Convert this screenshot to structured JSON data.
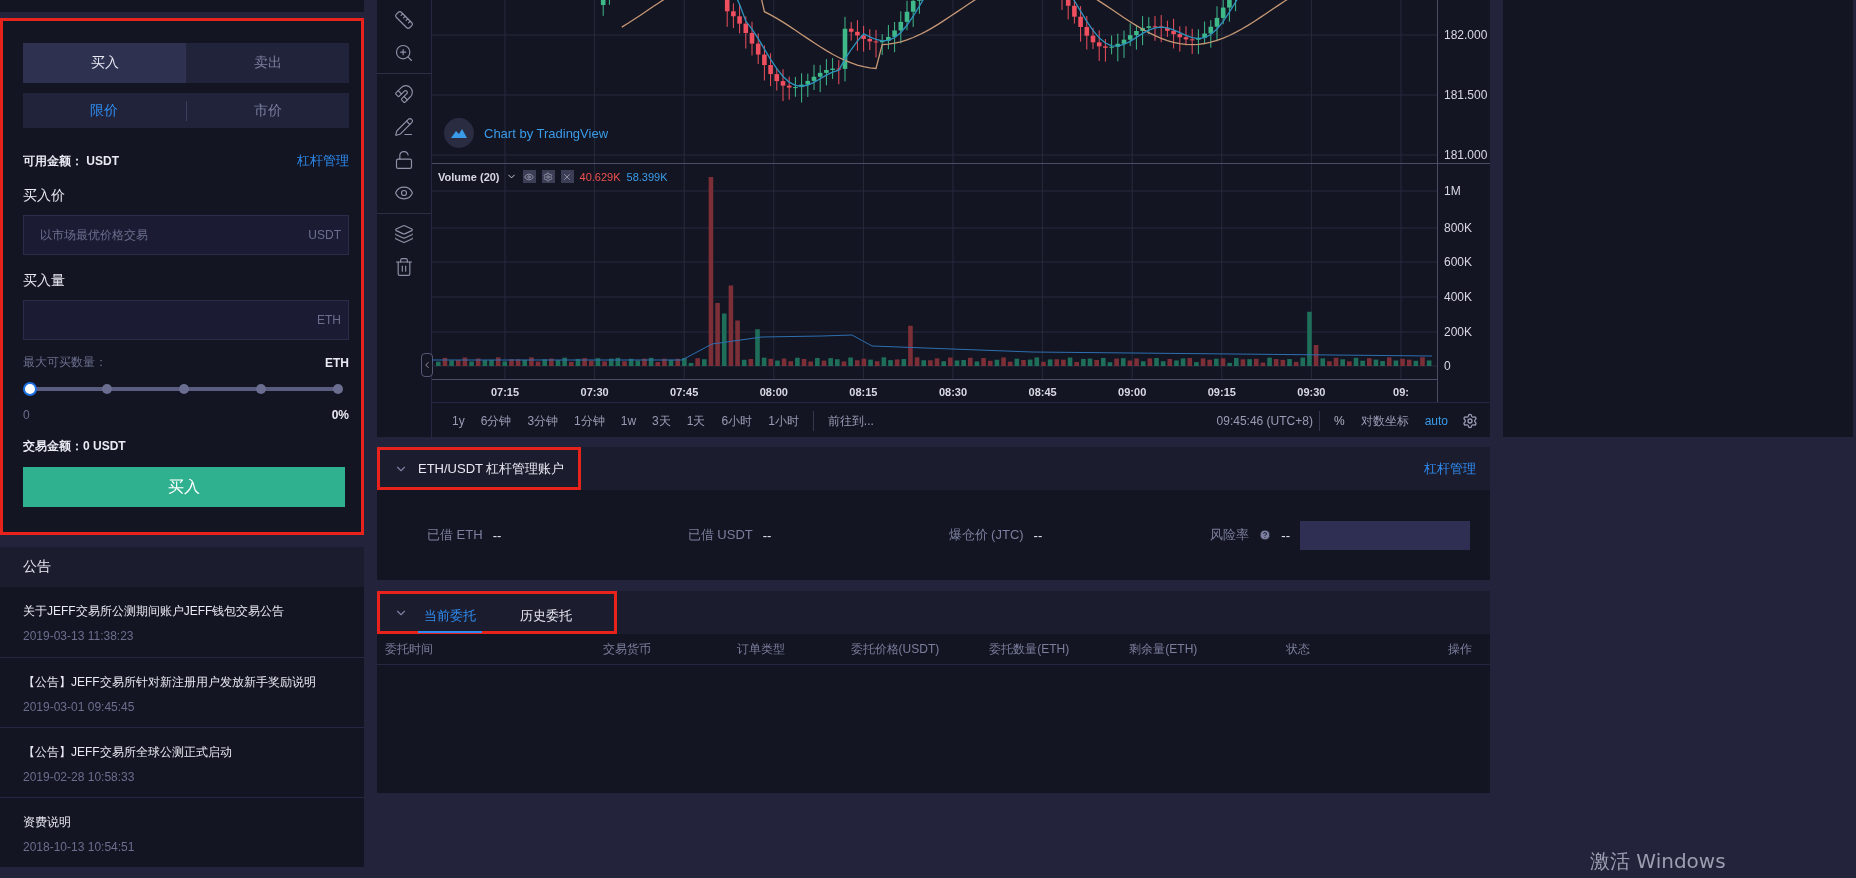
{
  "order_panel": {
    "annotated": true,
    "side_tabs": [
      {
        "label": "买入",
        "selected": true
      },
      {
        "label": "卖出",
        "selected": false
      }
    ],
    "type_tabs": [
      {
        "label": "限价",
        "selected": true
      },
      {
        "label": "市价",
        "selected": false
      }
    ],
    "available": "可用金额： USDT",
    "leverage_link": "杠杆管理",
    "price_label": "买入价",
    "price_field": {
      "placeholder": "以市场最优价格交易",
      "unit": "USDT"
    },
    "amount_label": "买入量",
    "amount_field": {
      "unit": "ETH"
    },
    "max_label": "最大可买数量：",
    "max_unit": "ETH",
    "slider": {
      "level": 0,
      "min_label": "0",
      "percent": "0%"
    },
    "total": "交易金额：0  USDT",
    "submit": "买入"
  },
  "notices": {
    "title": "公告",
    "items": [
      {
        "title": "关于JEFF交易所公测期间账户JEFF钱包交易公告",
        "time": "2019-03-13 11:38:23"
      },
      {
        "title": "【公告】JEFF交易所针对新注册用户发放新手奖励说明",
        "time": "2019-03-01 09:45:45"
      },
      {
        "title": "【公告】JEFF交易所全球公测正式启动",
        "time": "2019-02-28 10:58:33"
      },
      {
        "title": "资费说明",
        "time": "2018-10-13 10:54:51"
      }
    ]
  },
  "chart": {
    "attribution": "Chart by TradingView",
    "price_ticks": [
      "182.000",
      "181.500",
      "181.000"
    ],
    "volume_legend": {
      "label": "Volume (20)",
      "values": [
        {
          "text": "40.629K",
          "color": "#f0504f"
        },
        {
          "text": "58.399K",
          "color": "#3a9be8"
        }
      ]
    },
    "volume_ticks": [
      "1M",
      "800K",
      "600K",
      "400K",
      "200K",
      "0"
    ],
    "time_ticks": [
      "07:15",
      "07:30",
      "07:45",
      "08:00",
      "08:15",
      "08:30",
      "08:45",
      "09:00",
      "09:15",
      "09:30",
      "09:"
    ],
    "intervals": [
      "1y",
      "6分钟",
      "3分钟",
      "1分钟",
      "1w",
      "3天",
      "1天",
      "6小时",
      "1小时"
    ],
    "goto": "前往到...",
    "clock": "09:45:46 (UTC+8)",
    "percent": "%",
    "log_scale": "对数坐标",
    "auto": "auto"
  },
  "margin_account": {
    "expanded": true,
    "annotated": true,
    "title": "ETH/USDT 杠杆管理账户",
    "link": "杠杆管理",
    "stats": [
      {
        "kind": "plain",
        "label": "已借 ETH",
        "value": "--"
      },
      {
        "kind": "plain",
        "label": "已借 USDT",
        "value": "--"
      },
      {
        "kind": "plain",
        "label": "爆仓价 (JTC)",
        "value": "--"
      },
      {
        "kind": "risk",
        "label": "风险率",
        "value": "--"
      }
    ]
  },
  "orders": {
    "expanded": true,
    "annotated": true,
    "tabs": [
      {
        "label": "当前委托",
        "selected": true
      },
      {
        "label": "历史委托",
        "selected": false
      }
    ],
    "columns": [
      "委托时间",
      "交易货币",
      "订单类型",
      "委托价格(USDT)",
      "委托数量(ETH)",
      "剩余量(ETH)",
      "状态",
      "操作"
    ]
  },
  "os_notice": "激活 Windows"
}
